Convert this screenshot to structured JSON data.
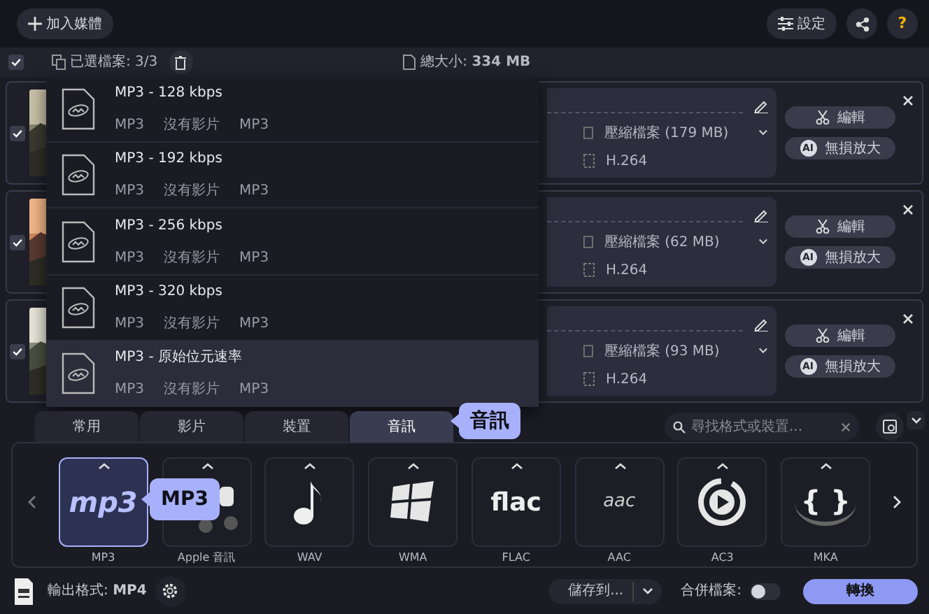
{
  "toolbar": {
    "add_media": "加入媒體",
    "settings": "設定",
    "help": "?"
  },
  "selection_bar": {
    "checked": true,
    "selected_files": "已選檔案: 3/3",
    "total_size": "總大小: **334 MB**"
  },
  "files": [
    {
      "checked": true,
      "compression": "壓縮檔案 (179 MB)",
      "codec": "H.264",
      "edit": "編輯",
      "upscale": "無損放大",
      "ai_badge": "AI"
    },
    {
      "checked": true,
      "compression": "壓縮檔案 (62 MB)",
      "codec": "H.264",
      "edit": "編輯",
      "upscale": "無損放大",
      "ai_badge": "AI"
    },
    {
      "checked": true,
      "compression": "壓縮檔案 (93 MB)",
      "codec": "H.264",
      "edit": "編輯",
      "upscale": "無損放大",
      "ai_badge": "AI"
    }
  ],
  "format_menu": [
    {
      "title": "MP3 - 128 kbps",
      "audio": "MP3",
      "video": "沒有影片",
      "container": "MP3",
      "selected": false
    },
    {
      "title": "MP3 - 192 kbps",
      "audio": "MP3",
      "video": "沒有影片",
      "container": "MP3",
      "selected": false
    },
    {
      "title": "MP3 - 256 kbps",
      "audio": "MP3",
      "video": "沒有影片",
      "container": "MP3",
      "selected": false
    },
    {
      "title": "MP3 - 320 kbps",
      "audio": "MP3",
      "video": "沒有影片",
      "container": "MP3",
      "selected": false
    },
    {
      "title": "MP3 - 原始位元速率",
      "audio": "MP3",
      "video": "沒有影片",
      "container": "MP3",
      "selected": true
    }
  ],
  "tabs": [
    {
      "label": "常用",
      "selected": false
    },
    {
      "label": "影片",
      "selected": false
    },
    {
      "label": "裝置",
      "selected": false
    },
    {
      "label": "音訊",
      "selected": true
    }
  ],
  "tab_tooltip": "音訊",
  "search": {
    "placeholder": "尋找格式或裝置..."
  },
  "formats": [
    {
      "label": "MP3",
      "kind": "mp3",
      "logo": "mp3",
      "selected": true
    },
    {
      "label": "Apple 音訊",
      "kind": "apple",
      "selected": false
    },
    {
      "label": "WAV",
      "kind": "note",
      "selected": false
    },
    {
      "label": "WMA",
      "kind": "windows",
      "selected": false
    },
    {
      "label": "FLAC",
      "kind": "flac",
      "logo": "flac",
      "selected": false
    },
    {
      "label": "AAC",
      "kind": "aac",
      "logo": "aac",
      "selected": false
    },
    {
      "label": "AC3",
      "kind": "play",
      "selected": false
    },
    {
      "label": "MKA",
      "kind": "braces",
      "logo": "{ }",
      "selected": false
    }
  ],
  "format_tooltip": "MP3",
  "bottom": {
    "output_format": "輸出格式: **MP4**",
    "save_to": "儲存到...",
    "merge_label": "合併檔案:",
    "merge_on": false,
    "convert": "轉換"
  }
}
